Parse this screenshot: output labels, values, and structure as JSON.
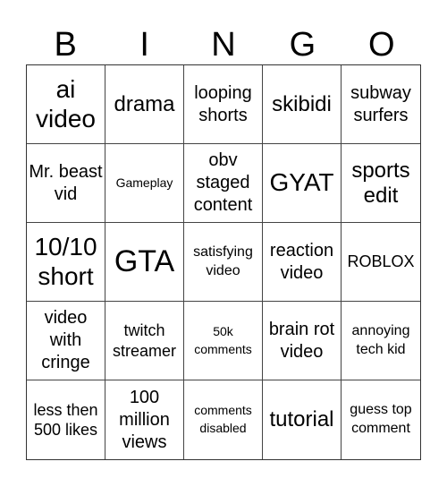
{
  "header": {
    "letters": [
      "B",
      "I",
      "N",
      "G",
      "O"
    ]
  },
  "board": {
    "rows": [
      [
        "ai video",
        "drama",
        "looping shorts",
        "skibidi",
        "subway surfers"
      ],
      [
        "Mr. beast vid",
        "Gameplay",
        "obv staged content",
        "GYAT",
        "sports edit"
      ],
      [
        "10/10 short",
        "GTA",
        "satisfying video",
        "reaction video",
        "ROBLOX"
      ],
      [
        "video with cringe",
        "twitch streamer",
        "50k comments",
        "brain rot video",
        "annoying tech kid"
      ],
      [
        "less then 500 likes",
        "100 million views",
        "comments disabled",
        "tutorial",
        "guess top comment"
      ]
    ]
  }
}
